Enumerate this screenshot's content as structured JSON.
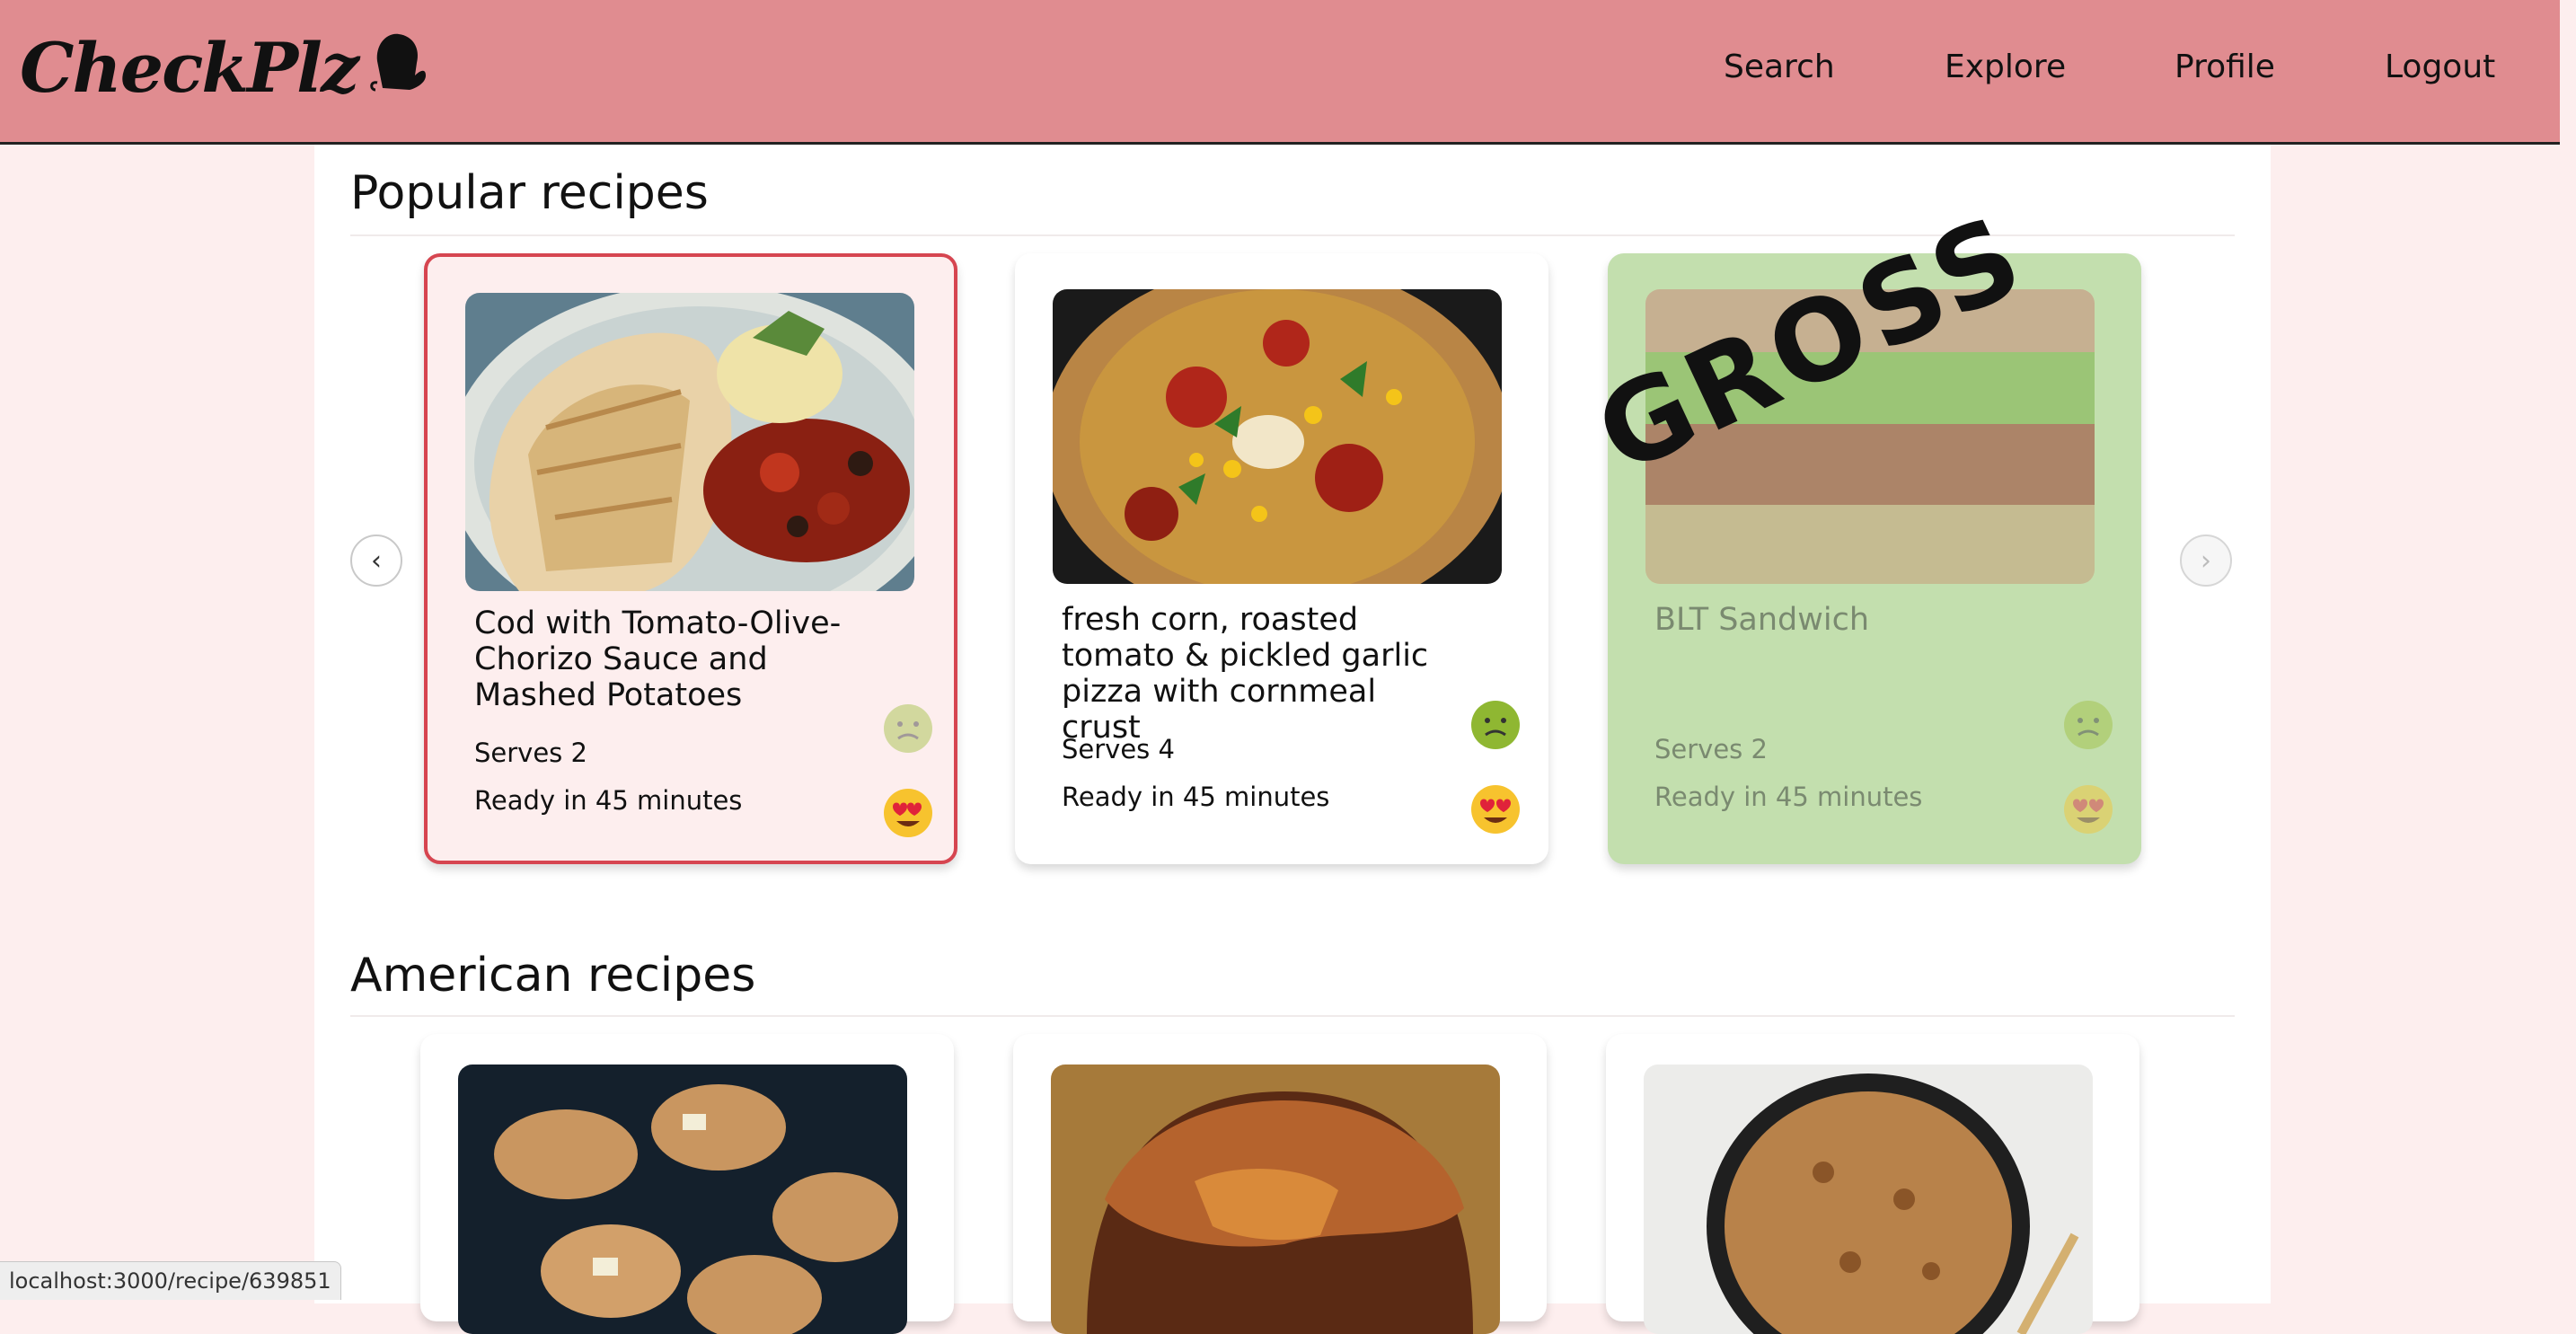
{
  "app": {
    "logo": "CheckPlz"
  },
  "nav": {
    "search": "Search",
    "explore": "Explore",
    "profile": "Profile",
    "logout": "Logout"
  },
  "sections": {
    "popular": {
      "title": "Popular recipes",
      "cards": [
        {
          "title": "Cod with Tomato-Olive-Chorizo Sauce and Mashed Potatoes",
          "serves": "Serves 2",
          "ready": "Ready in 45 minutes"
        },
        {
          "title": "fresh corn, roasted tomato & pickled garlic pizza with cornmeal crust",
          "serves": "Serves 4",
          "ready": "Ready in 45 minutes"
        },
        {
          "title": "BLT Sandwich",
          "serves": "Serves 2",
          "ready": "Ready in 45 minutes",
          "stamp": "GROSS"
        }
      ]
    },
    "american": {
      "title": "American recipes"
    }
  },
  "carousel": {
    "prev": "‹",
    "next": "›"
  },
  "icons": {
    "logo": "oven-mitt-icon",
    "dislike": "nauseated-face-icon",
    "like": "heart-eyes-icon"
  },
  "colors": {
    "header": "#e08c90",
    "background": "#fdeeee",
    "selected_border": "#d64550",
    "gross_card": "#c3dfae"
  },
  "status_bar": {
    "url": "localhost:3000/recipe/639851"
  }
}
